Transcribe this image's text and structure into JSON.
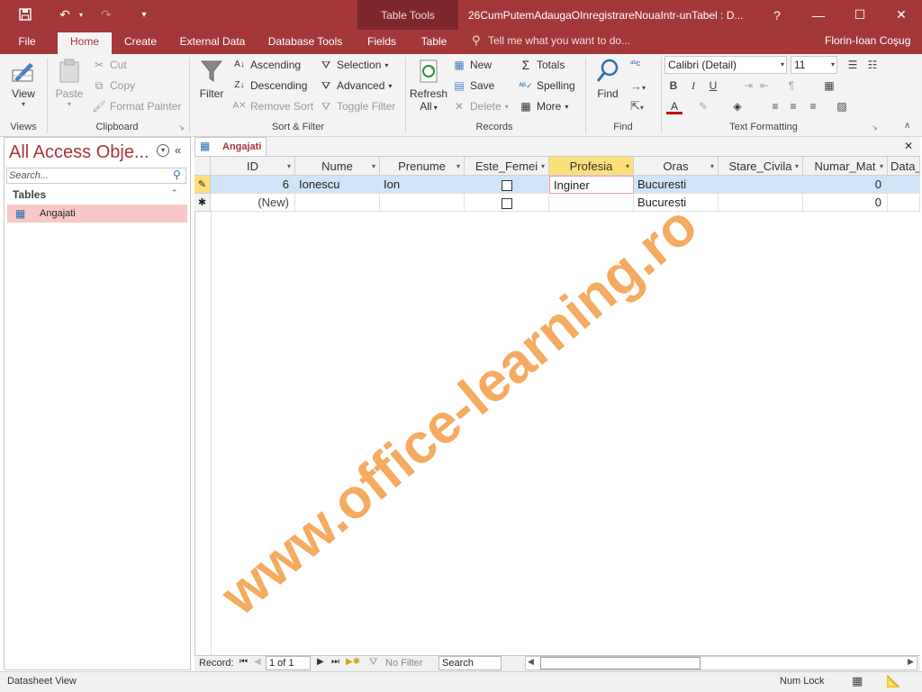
{
  "titlebar": {
    "doc_title": "26CumPutemAdaugaOInregistrareNouaIntr-unTabel : D...",
    "context_title": "Table Tools",
    "help": "?",
    "minimize": "—",
    "maximize": "☐",
    "close": "✕"
  },
  "tabs": {
    "file": "File",
    "home": "Home",
    "create": "Create",
    "external": "External Data",
    "dbtools": "Database Tools",
    "fields": "Fields",
    "table": "Table",
    "tellme": "Tell me what you want to do...",
    "user": "Florin-Ioan Coşug"
  },
  "ribbon": {
    "views": {
      "label": "Views",
      "view": "View"
    },
    "clipboard": {
      "label": "Clipboard",
      "paste": "Paste",
      "cut": "Cut",
      "copy": "Copy",
      "format_painter": "Format Painter"
    },
    "sortfilter": {
      "label": "Sort & Filter",
      "filter": "Filter",
      "ascending": "Ascending",
      "descending": "Descending",
      "remove_sort": "Remove Sort",
      "selection": "Selection",
      "advanced": "Advanced",
      "toggle_filter": "Toggle Filter"
    },
    "records": {
      "label": "Records",
      "refresh": "Refresh",
      "refresh2": "All",
      "new": "New",
      "save": "Save",
      "delete": "Delete",
      "totals": "Totals",
      "spelling": "Spelling",
      "more": "More"
    },
    "find": {
      "label": "Find",
      "find": "Find"
    },
    "textfmt": {
      "label": "Text Formatting",
      "font": "Calibri (Detail)",
      "size": "11",
      "bold": "B",
      "italic": "I",
      "underline": "U"
    }
  },
  "nav": {
    "title": "All Access Obje...",
    "search_placeholder": "Search...",
    "group": "Tables",
    "item": "Angajati"
  },
  "document": {
    "tab": "Angajati",
    "close": "✕",
    "columns": [
      "ID",
      "Nume",
      "Prenume",
      "Este_Femei",
      "Profesia",
      "Oras",
      "Stare_Civila",
      "Numar_Mat",
      "Data_"
    ],
    "row1": {
      "id": "6",
      "nume": "Ionescu",
      "prenume": "Ion",
      "profesia": "Inginer",
      "oras": "Bucuresti",
      "numar": "0"
    },
    "newrow": {
      "id": "(New)",
      "oras": "Bucuresti",
      "numar": "0"
    }
  },
  "recnav": {
    "label": "Record:",
    "position": "1 of 1",
    "nofilter": "No Filter",
    "search": "Search"
  },
  "status": {
    "view": "Datasheet View",
    "numlock": "Num Lock"
  },
  "watermark": "www.office-learning.ro",
  "colors": {
    "accent": "#a4373a",
    "selected_header": "#fde07a",
    "row_highlight": "#cfe4f8"
  }
}
